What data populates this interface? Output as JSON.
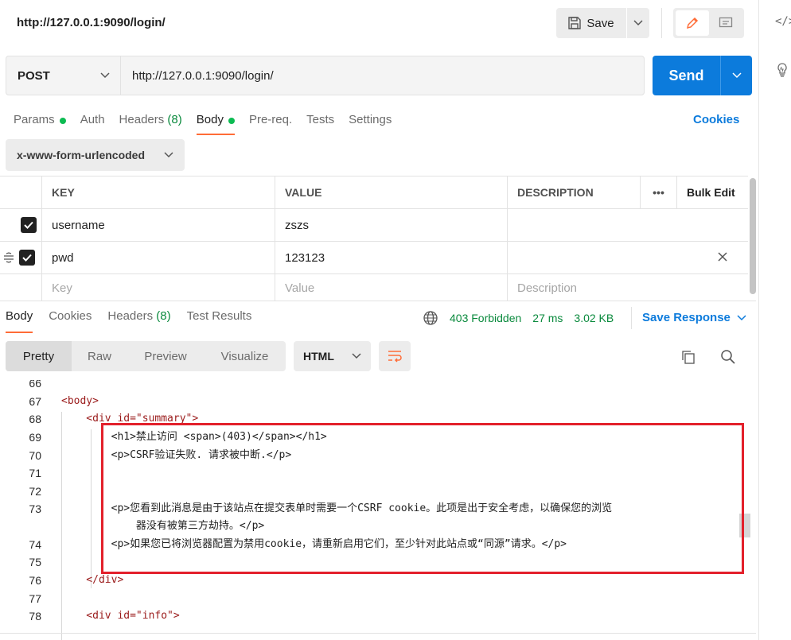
{
  "request": {
    "title": "http://127.0.0.1:9090/login/",
    "save_label": "Save",
    "method": "POST",
    "url": "http://127.0.0.1:9090/login/",
    "send_label": "Send"
  },
  "request_tabs": [
    {
      "label": "Params",
      "has_dot": true
    },
    {
      "label": "Auth"
    },
    {
      "label": "Headers",
      "count": "(8)"
    },
    {
      "label": "Body",
      "has_dot": true,
      "active": true
    },
    {
      "label": "Pre-req."
    },
    {
      "label": "Tests"
    },
    {
      "label": "Settings"
    }
  ],
  "cookies_label": "Cookies",
  "body_type": "x-www-form-urlencoded",
  "kv_table": {
    "headers": {
      "key": "KEY",
      "value": "VALUE",
      "description": "DESCRIPTION",
      "more": "•••",
      "bulk_edit": "Bulk Edit"
    },
    "rows": [
      {
        "key": "username",
        "value": "zszs",
        "description": "",
        "checked": true
      },
      {
        "key": "pwd",
        "value": "123123",
        "description": "",
        "checked": true
      }
    ],
    "placeholders": {
      "key": "Key",
      "value": "Value",
      "description": "Description"
    }
  },
  "response": {
    "tabs": [
      {
        "label": "Body",
        "active": true
      },
      {
        "label": "Cookies"
      },
      {
        "label": "Headers",
        "count": "(8)"
      },
      {
        "label": "Test Results"
      }
    ],
    "status": "403 Forbidden",
    "time": "27 ms",
    "size": "3.02 KB",
    "save_response_label": "Save Response",
    "view_tabs": [
      "Pretty",
      "Raw",
      "Preview",
      "Visualize"
    ],
    "language": "HTML"
  },
  "code_lines": [
    {
      "n": "66",
      "text": ""
    },
    {
      "n": "67",
      "text": "<body>"
    },
    {
      "n": "68",
      "text": "    <div id=\"summary\">"
    },
    {
      "n": "69",
      "text": "        <h1>禁止访问 <span>(403)</span></h1>"
    },
    {
      "n": "70",
      "text": "        <p>CSRF验证失败. 请求被中断.</p>"
    },
    {
      "n": "71",
      "text": ""
    },
    {
      "n": "72",
      "text": ""
    },
    {
      "n": "73",
      "text": "        <p>您看到此消息是由于该站点在提交表单时需要一个CSRF cookie。此项是出于安全考虑，以确保您的浏览"
    },
    {
      "n": "",
      "text": "            器没有被第三方劫持。</p>"
    },
    {
      "n": "74",
      "text": "        <p>如果您已将浏览器配置为禁用cookie，请重新启用它们，至少针对此站点或“同源”请求。</p>"
    },
    {
      "n": "75",
      "text": ""
    },
    {
      "n": "76",
      "text": "    </div>"
    },
    {
      "n": "77",
      "text": ""
    },
    {
      "n": "78",
      "text": "    <div id=\"info\">"
    }
  ],
  "colors": {
    "accent": "#ff6c37",
    "primary": "#0c7bdc",
    "success": "#0a8a3d",
    "highlight": "#e3202b"
  }
}
